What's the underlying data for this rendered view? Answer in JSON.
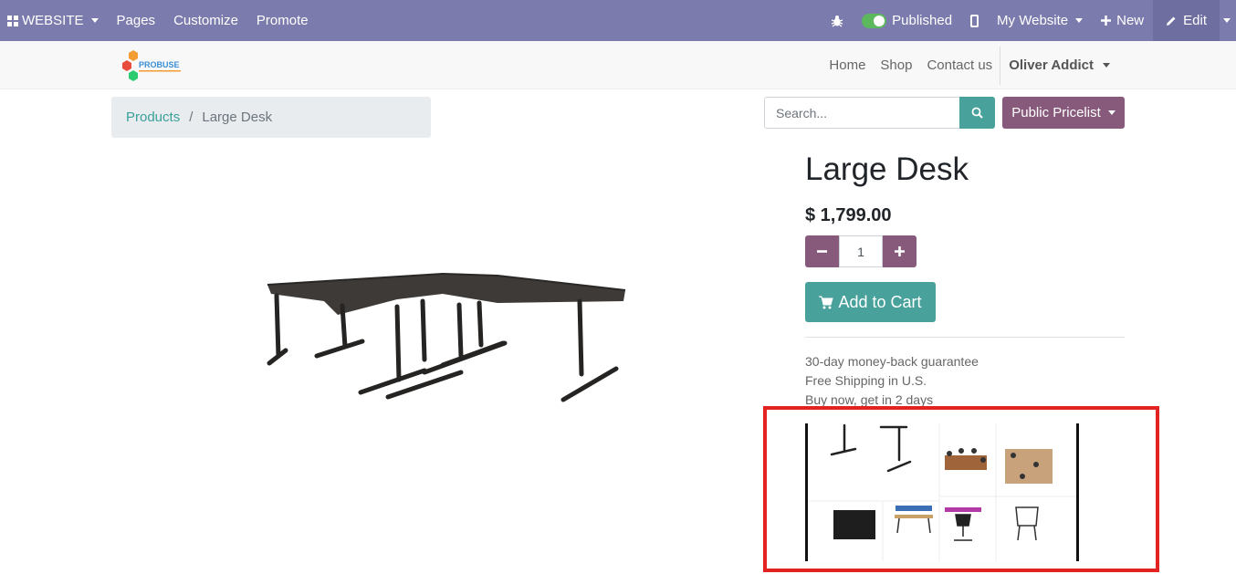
{
  "topbar": {
    "website_label": "WEBSITE",
    "pages_label": "Pages",
    "customize_label": "Customize",
    "promote_label": "Promote",
    "published_label": "Published",
    "my_website_label": "My Website",
    "new_label": "New",
    "edit_label": "Edit",
    "color": "#7c7bad"
  },
  "header": {
    "logo_text": "PROBUSE",
    "nav": [
      "Home",
      "Shop",
      "Contact us"
    ],
    "user": "Oliver Addict"
  },
  "breadcrumb": {
    "parent": "Products",
    "separator": "/",
    "current": "Large Desk"
  },
  "search": {
    "placeholder": "Search..."
  },
  "pricelist_label": "Public Pricelist",
  "product": {
    "name": "Large Desk",
    "price": "$ 1,799.00",
    "quantity": "1",
    "add_to_cart": "Add to Cart",
    "guarantee": [
      "30-day money-back guarantee",
      "Free Shipping in U.S.",
      "Buy now, get in 2 days"
    ]
  },
  "colors": {
    "accent_teal": "#48a29b",
    "accent_purple": "#875a7b",
    "highlight_red": "#e32222"
  }
}
